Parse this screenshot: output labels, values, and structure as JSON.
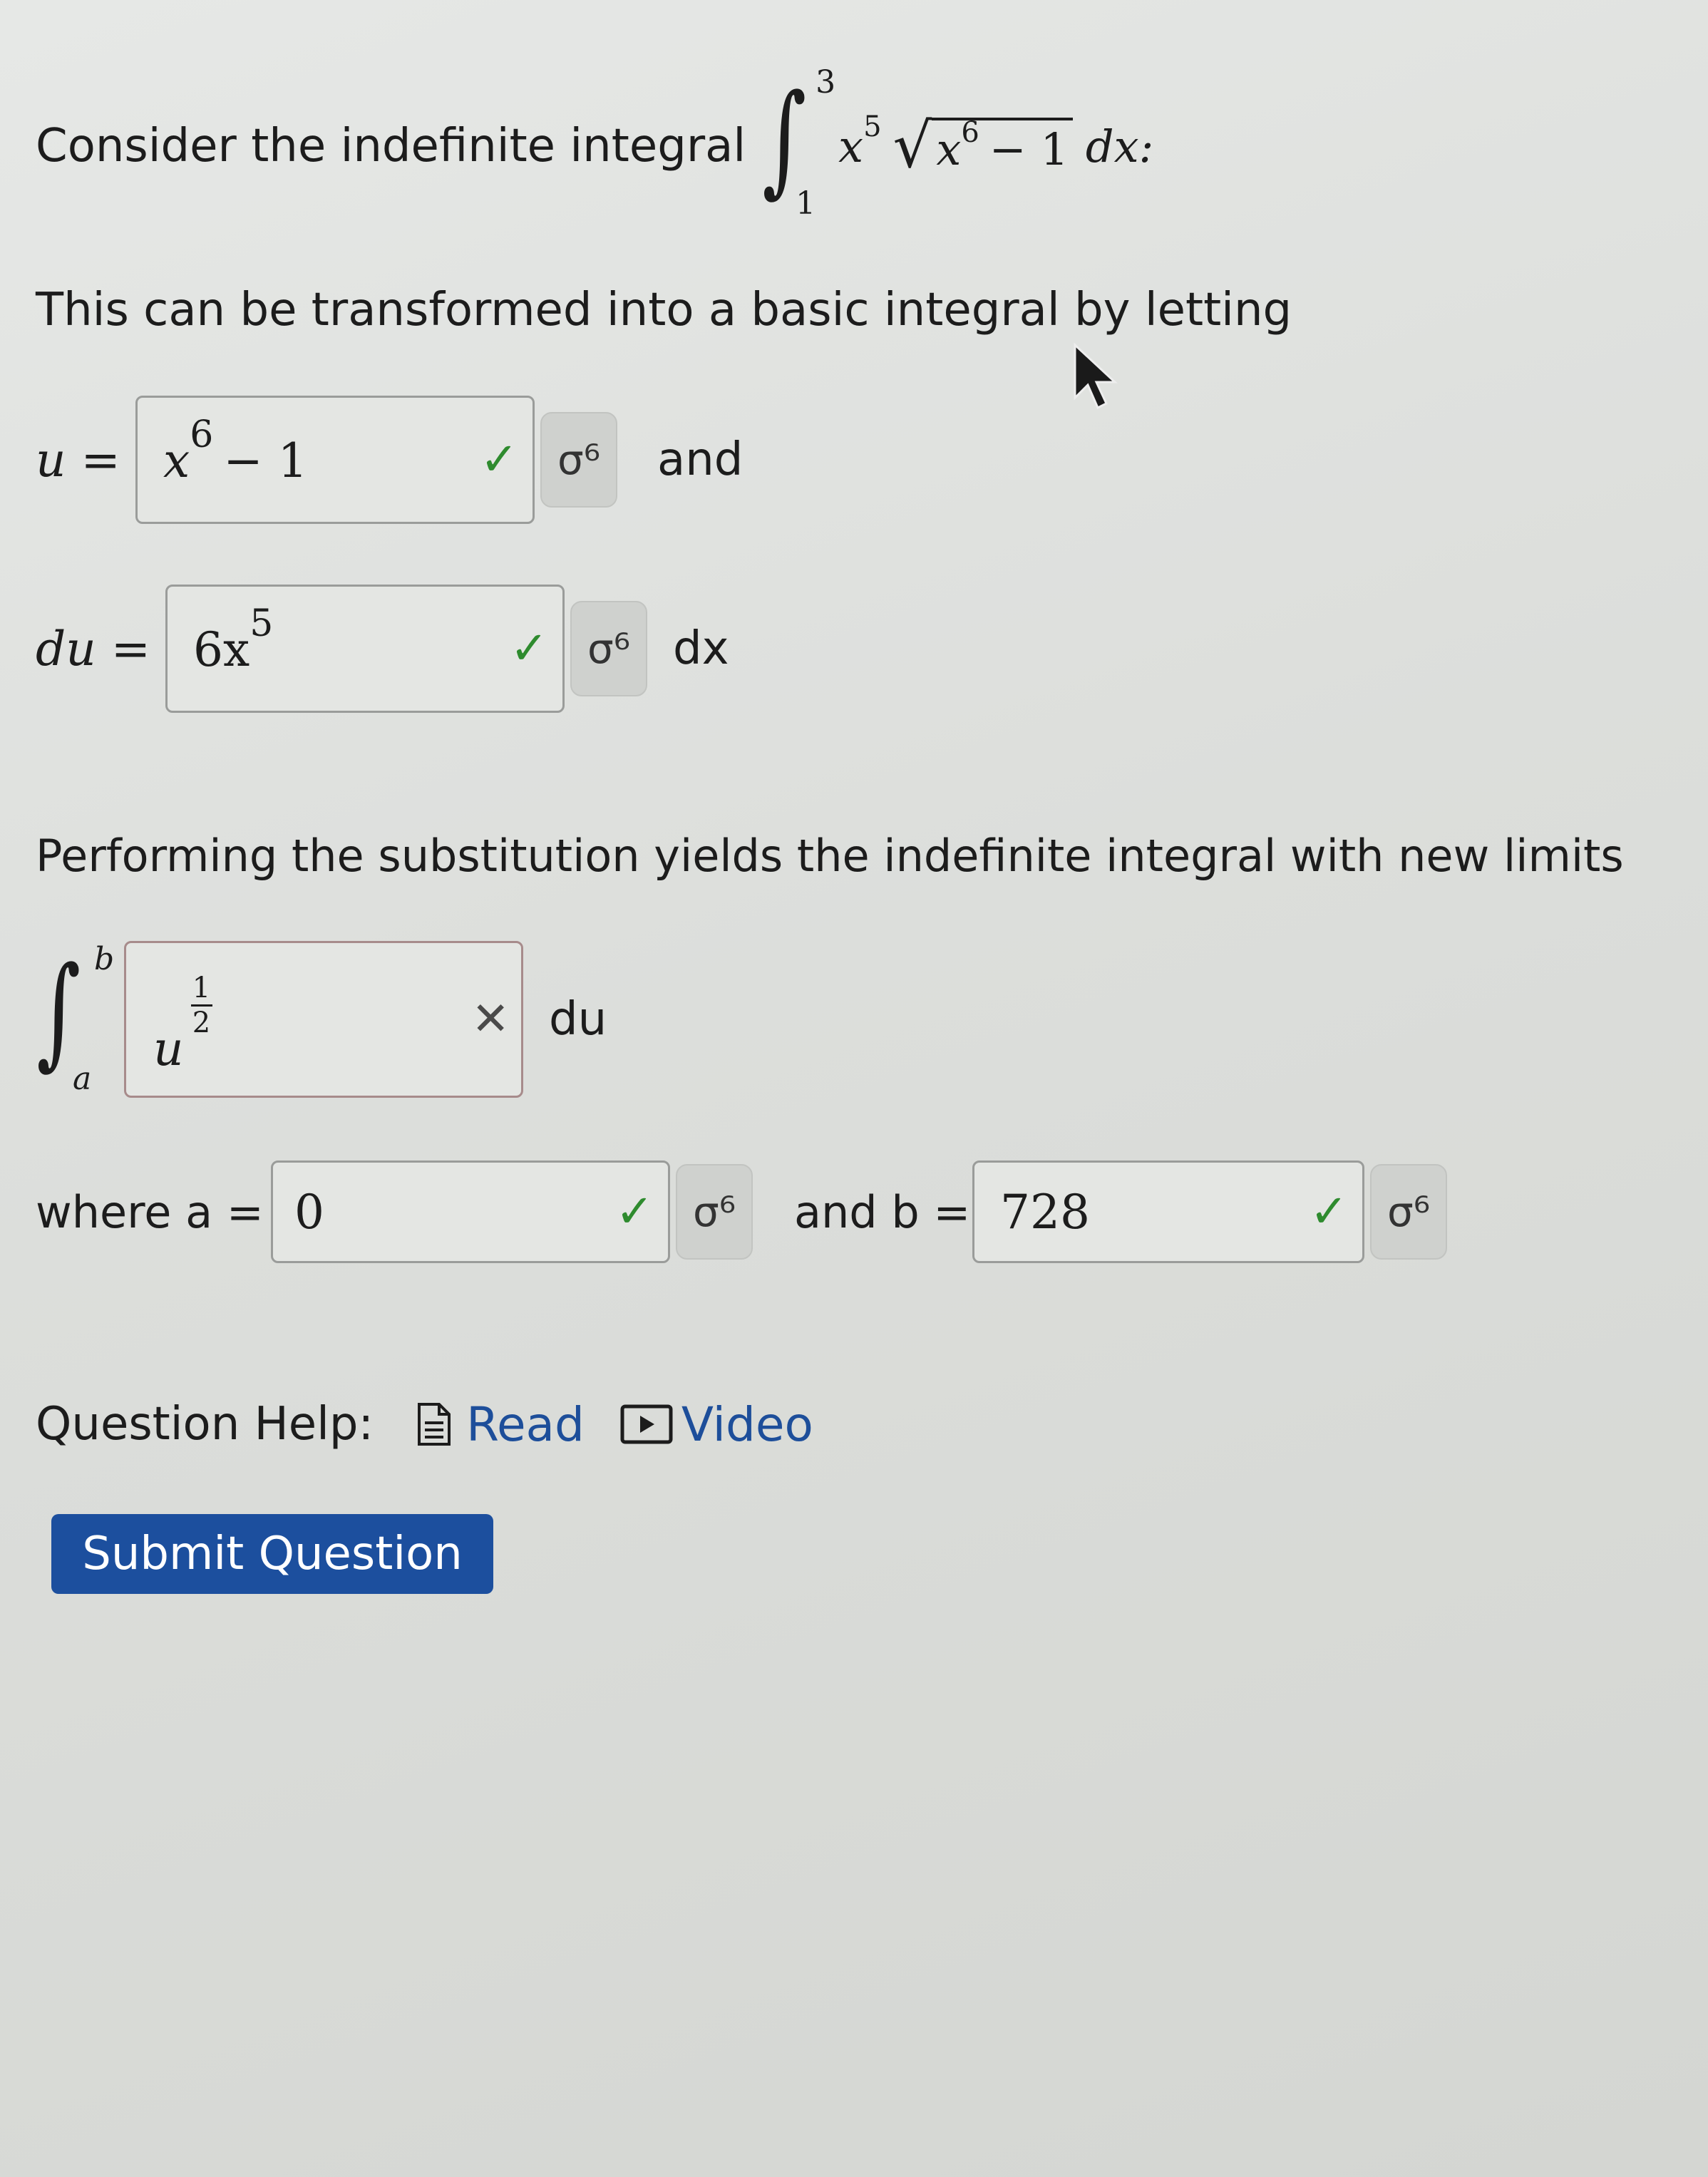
{
  "intro": {
    "prefix": "Consider the indefinite integral",
    "lower_limit": "1",
    "upper_limit": "3",
    "integrand_x": "x",
    "integrand_exp5": "5",
    "radicand_x": "x",
    "radicand_exp6": "6",
    "radicand_tail": "− 1",
    "differential": "dx:"
  },
  "transform_text": "This can be transformed into a basic integral by letting",
  "u_line": {
    "label": "u =",
    "value_base": "x",
    "value_exp": "6",
    "value_tail": "− 1",
    "status": "✓",
    "preview_icon": "σ⁶",
    "suffix": "and"
  },
  "du_line": {
    "label": "du =",
    "value_base": "6x",
    "value_exp": "5",
    "status": "✓",
    "preview_icon": "σ⁶",
    "suffix": "dx"
  },
  "substitution_text": "Performing the substitution yields the indefinite integral with new limits",
  "new_integral": {
    "lower_limit": "a",
    "upper_limit": "b",
    "value_base": "u",
    "exp_num": "1",
    "exp_den": "2",
    "status": "✕",
    "suffix": "du"
  },
  "limits_line": {
    "a_label": "where a =",
    "a_value": "0",
    "a_status": "✓",
    "b_label": "and b =",
    "b_value": "728",
    "b_status": "✓",
    "preview_icon": "σ⁶"
  },
  "help": {
    "label": "Question Help:",
    "read_label": "Read",
    "video_label": "Video"
  },
  "submit_label": "Submit Question",
  "colors": {
    "check": "#2e8b2e",
    "link": "#1d4e9a",
    "submit_bg": "#1c4f9e"
  },
  "icons": {
    "read": "document-icon",
    "video": "play-icon",
    "preview": "preview-icon"
  }
}
